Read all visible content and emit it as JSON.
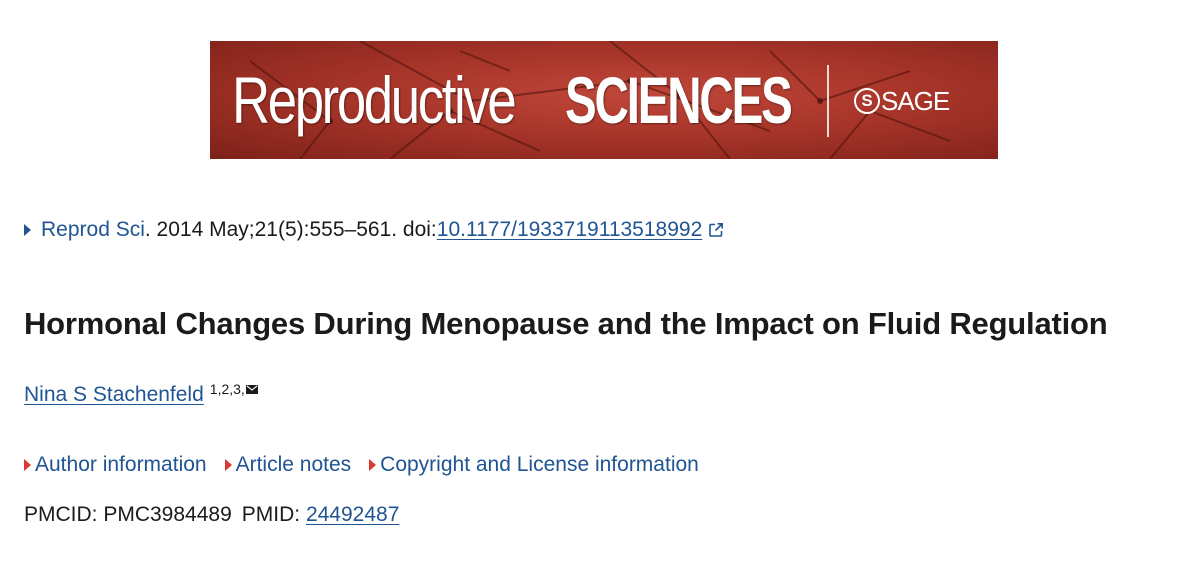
{
  "banner": {
    "journal_name_light": "Reproductive",
    "journal_name_bold": "SCIENCES",
    "publisher_glyph": "S",
    "publisher_name": "SAGE",
    "colors": {
      "background": "#a8352a",
      "text": "#ffffff"
    }
  },
  "citation": {
    "journal_abbrev": "Reprod Sci",
    "details": ". 2014 May;21(5):555–561. doi: ",
    "doi": "10.1177/1933719113518992",
    "icon": "external-link-icon"
  },
  "article": {
    "title": "Hormonal Changes During Menopause and the Impact on Fluid Regulation"
  },
  "author": {
    "name": "Nina S Stachenfeld",
    "affiliations": "1,2,3,",
    "icon": "envelope-icon"
  },
  "toggles": [
    {
      "label": "Author information"
    },
    {
      "label": "Article notes"
    },
    {
      "label": "Copyright and License information"
    }
  ],
  "ids": {
    "pmcid_label": "PMCID: PMC3984489",
    "pmid_label": "PMID: ",
    "pmid_value": "24492487"
  },
  "colors": {
    "link": "#205493",
    "toggle_arrow": "#d83933",
    "text": "#1b1b1b"
  }
}
